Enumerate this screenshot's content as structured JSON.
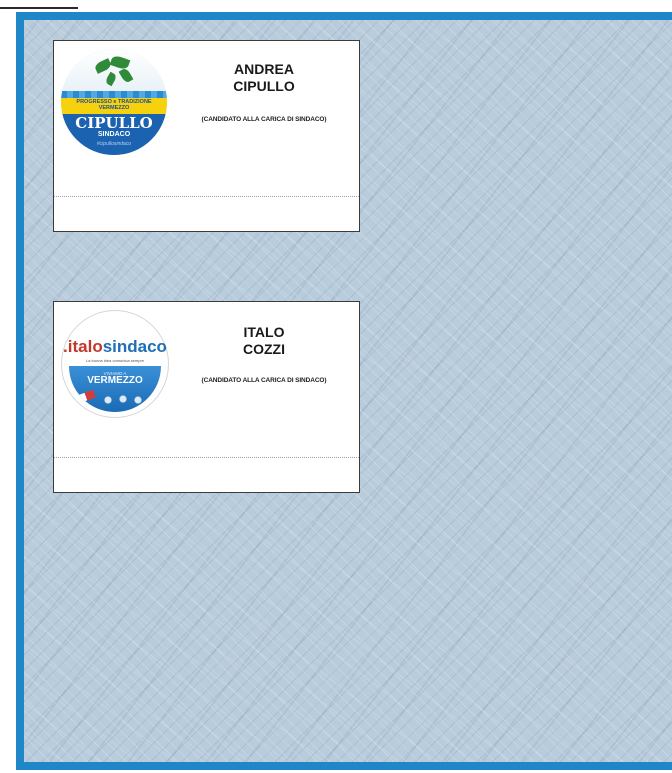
{
  "ballot": {
    "candidates": [
      {
        "name_line1": "ANDREA",
        "name_line2": "CIPULLO",
        "role": "(CANDIDATO ALLA CARICA DI SINDACO)",
        "logo": {
          "top_text": "PROGRESSO e TRADIZIONE",
          "top_text2": "VERMEZZO",
          "main_text": "CIPULLO",
          "sub_text": "SINDACO",
          "hashtag": "#cipullosindaco",
          "colors": {
            "yellow": "#f5d20d",
            "blue": "#1b62b0",
            "leaf": "#2f8a3a"
          }
        }
      },
      {
        "name_line1": "ITALO",
        "name_line2": "COZZI",
        "role": "(CANDIDATO ALLA CARICA DI SINDACO)",
        "logo": {
          "prefix": ".italo",
          "main_text": "sindaco",
          "tagline": "La buona idea comunica sempre",
          "small_text": "VIVIAMO A",
          "place": "VERMEZZO",
          "colors": {
            "red": "#c0392b",
            "blue": "#1f6fb7"
          }
        }
      }
    ],
    "colors": {
      "frame_border": "#1f86c8",
      "frame_background": "#b9ccdc"
    }
  }
}
